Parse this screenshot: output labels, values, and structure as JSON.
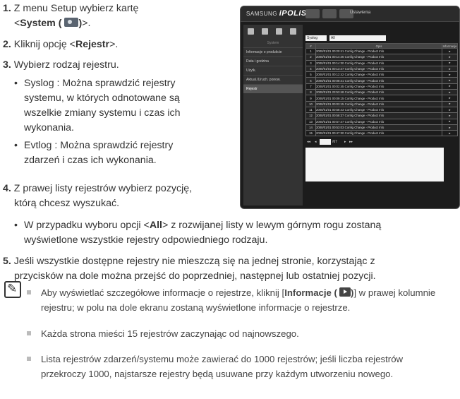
{
  "steps": [
    {
      "num": "1.",
      "line1": "Z menu Setup wybierz kartę",
      "line2_pre": "<",
      "line2_bold": "System (",
      "line2_bold_end": ")",
      "line2_post": ">."
    },
    {
      "num": "2.",
      "pre": "Kliknij opcję <",
      "bold": "Rejestr",
      "post": ">."
    },
    {
      "num": "3.",
      "text": "Wybierz rodzaj rejestru."
    },
    {
      "num": "4.",
      "line1": "Z prawej listy rejestrów wybierz pozycję,",
      "line2": "którą chcesz wyszukać."
    },
    {
      "num": "5.",
      "line1": "Jeśli wszystkie dostępne rejestry nie mieszczą się na jednej stronie, korzystając z",
      "line2": "przycisków na dole można przejść do poprzedniej, następnej lub ostatniej pozycji."
    }
  ],
  "step3_bullets": [
    {
      "lines": [
        "Syslog : Można sprawdzić rejestry",
        "systemu, w których odnotowane są",
        "wszelkie zmiany systemu i czas ich",
        "wykonania."
      ]
    },
    {
      "lines": [
        "Evtlog : Można sprawdzić rejestry",
        "zdarzeń i czas ich wykonania."
      ]
    }
  ],
  "step4_bullet": {
    "pre": "W przypadku wyboru opcji <",
    "bold": "All",
    "post": "> z rozwijanej listy w lewym górnym rogu zostaną",
    "line2": "wyświetlone wszystkie rejestry odpowiedniego rodzaju."
  },
  "notes": [
    {
      "pre": "Aby wyświetlać szczegółowe informacje o rejestrze, kliknij [",
      "bold": "Informacje (",
      "bold_end": ")",
      "post": "] w prawej kolumnie",
      "line2": "rejestru; w polu na dole ekranu zostaną wyświetlone informacje o rejestrze."
    },
    {
      "text": "Każda strona mieści 15 rejestrów zaczynając od najnowszego."
    },
    {
      "line1": "Lista rejestrów zdarzeń/systemu może zawierać do 1000 rejestrów; jeśli liczba rejestrów",
      "line2": "przekroczy 1000, najstarsze rejestry będą usuwane przy każdym utworzeniu nowego."
    }
  ],
  "screenshot": {
    "brand_prefix": "SAMSUNG",
    "brand_main": "iPOLiS",
    "top_title": "Ustawienia",
    "sidebar_heading": "System",
    "sidebar_items": [
      "Informacje o produkcie",
      "Data i godzina",
      "Użytk.",
      "Aktual./Uruch. ponow.",
      "Rejestr"
    ],
    "filter_type": "Syslog",
    "filter_value": "All",
    "table_headers": [
      "#",
      "Opis",
      "Informacje"
    ],
    "rows": [
      {
        "n": "1",
        "desc": "2000/01/01 00:20:41 Config Change - Product Info"
      },
      {
        "n": "2",
        "desc": "2000/01/01 00:14:46 Config Change - Product Info"
      },
      {
        "n": "3",
        "desc": "2000/01/01 00:14:30 Config Change - Product Info"
      },
      {
        "n": "4",
        "desc": "2000/01/01 00:13:47 Config Change - Product Info"
      },
      {
        "n": "5",
        "desc": "2000/01/01 00:12:42 Config Change - Product Info"
      },
      {
        "n": "6",
        "desc": "2000/01/01 00:08:41 Config Change - Product Info"
      },
      {
        "n": "7",
        "desc": "2000/01/01 00:02:45 Config Change - Product Info"
      },
      {
        "n": "8",
        "desc": "2000/01/01 23:53:48 Config Change - Product Info"
      },
      {
        "n": "9",
        "desc": "2000/01/01 00:09:15 Config Change - Product Info"
      },
      {
        "n": "10",
        "desc": "2000/01/01 00:03:15 Config Change - Product Info"
      },
      {
        "n": "11",
        "desc": "2000/01/01 00:58:43 Config Change - Product Info"
      },
      {
        "n": "12",
        "desc": "2000/01/01 00:58:37 Config Change - Product Info"
      },
      {
        "n": "13",
        "desc": "2000/01/01 00:57:47 Config Change - Product Info"
      },
      {
        "n": "14",
        "desc": "2000/01/01 00:53:03 Config Change - Product Info"
      },
      {
        "n": "15",
        "desc": "2000/01/01 00:47:30 Config Change - Product Info"
      }
    ],
    "row_action": "▸",
    "pager_first": "◂◂",
    "pager_prev": "◂",
    "pager_total": "/67",
    "pager_next": "▸",
    "pager_last": "▸▸"
  }
}
